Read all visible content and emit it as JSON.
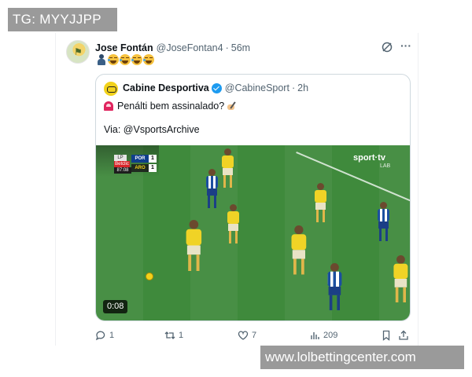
{
  "watermarks": {
    "top": "TG: MYYJJPP",
    "bottom": "www.lolbettingcenter.com"
  },
  "post": {
    "author_name": "Jose Fontán",
    "author_handle": "@JoseFontan4",
    "separator": "·",
    "time": "56m",
    "emoji_text": "🧏🤣🤣🤣🤣"
  },
  "quote": {
    "author_name": "Cabine Desportiva",
    "author_handle": "@CabineSport",
    "separator": "·",
    "time": "2h",
    "text_line1": "Penálti bem assinalado?",
    "text_line2": "Via: @VsportsArchive",
    "video": {
      "duration": "0:08",
      "broadcaster": "sport·tv",
      "broadcaster_sub": "LAB",
      "scoreboard": {
        "league_logo": "LP",
        "sponsor": "Betclic",
        "clock": "87:08",
        "team1": "POR",
        "team1_score": "1",
        "team2": "ARO",
        "team2_score": "1"
      }
    }
  },
  "actions": {
    "replies": "1",
    "reposts": "1",
    "likes": "7",
    "views": "209"
  },
  "colors": {
    "verified": "#1d9bf0",
    "pitch": "#3f8a3c",
    "muted_text": "#536471"
  }
}
